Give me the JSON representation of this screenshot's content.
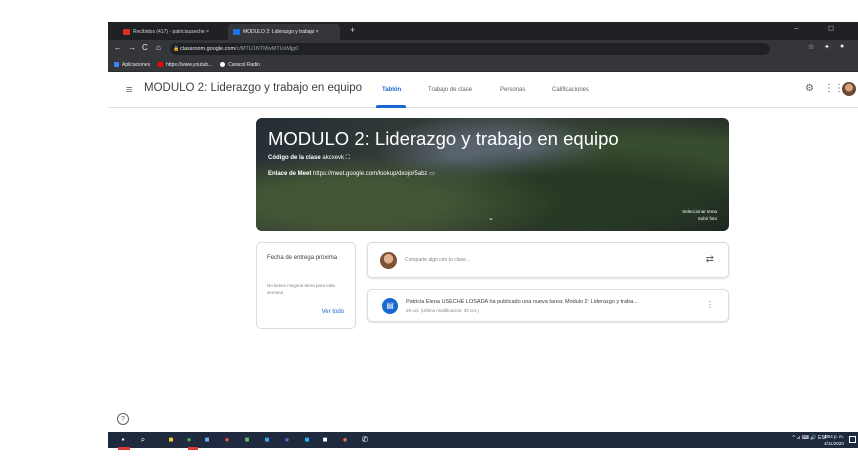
{
  "browser": {
    "tabs": [
      {
        "label": "Recibidos (417) - patriciauseche ×",
        "favicon": "gmail-icon"
      },
      {
        "label": "MODULO 2: Liderazgo y trabajo ×",
        "favicon": "classroom-icon"
      }
    ],
    "new_tab": "+",
    "window_controls": "– ◻",
    "url_host": "classroom.google.com",
    "url_path": "/c/MTU1NTMwMTUxMjg0",
    "bookmarks": [
      {
        "label": "Aplicaciones",
        "color": "#4285f4"
      },
      {
        "label": "https://www.youtub...",
        "color": "#ff0000"
      },
      {
        "label": "Caracol Radio",
        "color": "#ffffff"
      }
    ]
  },
  "header": {
    "title": "MODULO 2: Liderazgo y trabajo en equipo",
    "tabs": [
      "Tablón",
      "Trabajo de clase",
      "Personas",
      "Calificaciones"
    ],
    "active_tab": "Tablón"
  },
  "banner": {
    "title": "MODULO 2: Liderazgo y trabajo en equipo",
    "code_label": "Código de la clase",
    "code_value": "akcxevk",
    "meet_label": "Enlace de Meet",
    "meet_value": "https://meet.google.com/lookup/dxojor5abz",
    "theme_select": "Seleccionar tema",
    "theme_upload": "Subir foto"
  },
  "due": {
    "heading": "Fecha de entrega próxima",
    "text": "No tienes ninguna tarea para esta semana",
    "link": "Ver todo"
  },
  "share": {
    "placeholder": "Comparte algo con tu clase..."
  },
  "post": {
    "text": "Patricia Elena USECHE LOSADA ha publicado una nueva tarea: Modulo 2: Liderazgo y traba...",
    "date": "29 oct. (Última modificación: 30 oct.)"
  },
  "taskbar": {
    "tray": "^ ⊿ ⌨ 🔊 ESP",
    "time": "4:04 p. m.",
    "date": "4/11/2020"
  },
  "colors": {
    "accent": "#1967d2",
    "taskbar": "#1f2a3f"
  }
}
